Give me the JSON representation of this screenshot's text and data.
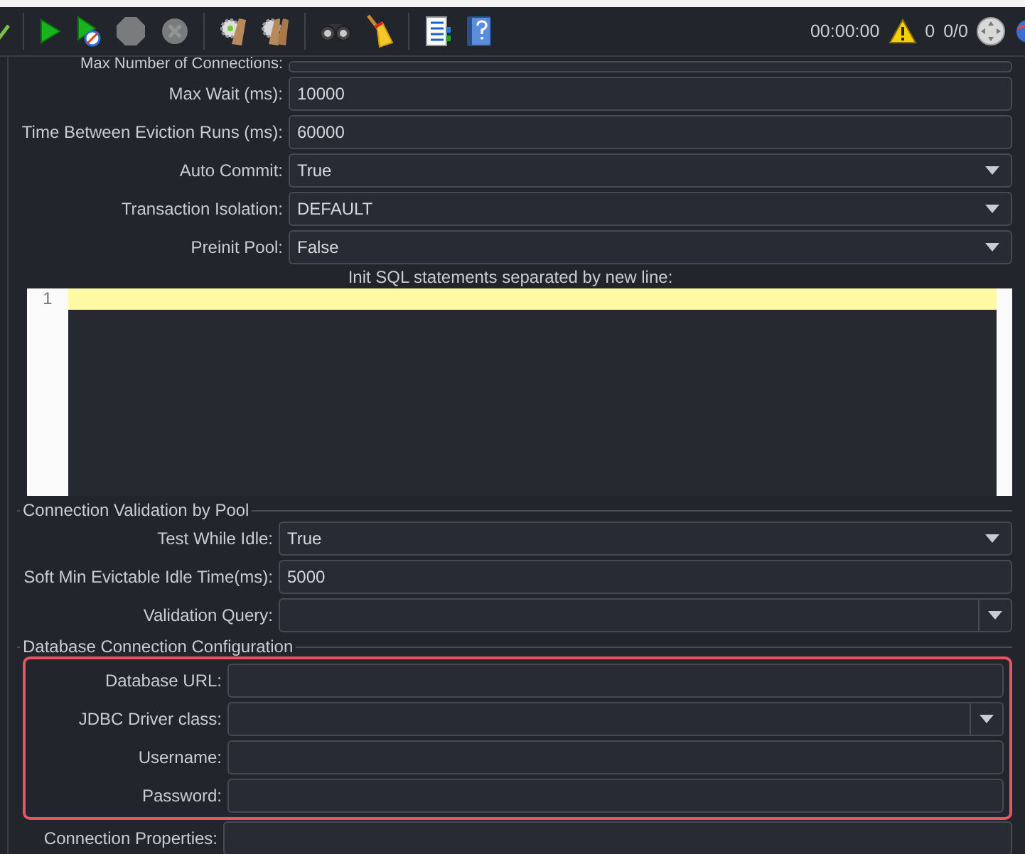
{
  "toolbar": {
    "groups": [
      [
        {
          "kind": "check",
          "disabled": false
        }
      ],
      [
        {
          "kind": "start",
          "disabled": false
        },
        {
          "kind": "start-no-timers",
          "disabled": false
        },
        {
          "kind": "stop",
          "disabled": true
        },
        {
          "kind": "shutdown",
          "disabled": true
        }
      ],
      [
        {
          "kind": "clear",
          "disabled": false
        },
        {
          "kind": "clear-all",
          "disabled": false
        }
      ],
      [
        {
          "kind": "search",
          "disabled": false
        },
        {
          "kind": "reset",
          "disabled": false
        }
      ],
      [
        {
          "kind": "function-helper",
          "disabled": false
        },
        {
          "kind": "help",
          "disabled": false
        }
      ]
    ],
    "timer": "00:00:00",
    "warnings": "0",
    "threads": "0/0"
  },
  "sections": [
    {
      "rows": [
        {
          "kind": "text-cut",
          "label": "Max Number of Connections:"
        },
        {
          "kind": "text",
          "label": "Max Wait (ms):",
          "value": "10000"
        },
        {
          "kind": "text",
          "label": "Time Between Eviction Runs (ms):",
          "value": "60000"
        },
        {
          "kind": "select",
          "label": "Auto Commit:",
          "value": "True"
        },
        {
          "kind": "select",
          "label": "Transaction Isolation:",
          "value": "DEFAULT"
        },
        {
          "kind": "select",
          "label": "Preinit Pool:",
          "value": "False"
        }
      ],
      "editor": {
        "label": "Init SQL statements separated by new line:",
        "line_numbers": [
          "1"
        ]
      }
    },
    {
      "legend": "Connection Validation by Pool",
      "rows": [
        {
          "kind": "select",
          "label": "Test While Idle:",
          "value": "True"
        },
        {
          "kind": "text",
          "label": "Soft Min Evictable Idle Time(ms):",
          "value": "5000"
        },
        {
          "kind": "combo",
          "label": "Validation Query:"
        }
      ]
    },
    {
      "legend": "Database Connection Configuration",
      "highlighted": true,
      "rows": [
        {
          "kind": "text",
          "label": "Database URL:"
        },
        {
          "kind": "combo",
          "label": "JDBC Driver class:"
        },
        {
          "kind": "text",
          "label": "Username:"
        },
        {
          "kind": "text",
          "label": "Password:"
        }
      ]
    },
    {
      "rows": [
        {
          "kind": "text",
          "label": "Connection Properties:"
        }
      ]
    }
  ]
}
